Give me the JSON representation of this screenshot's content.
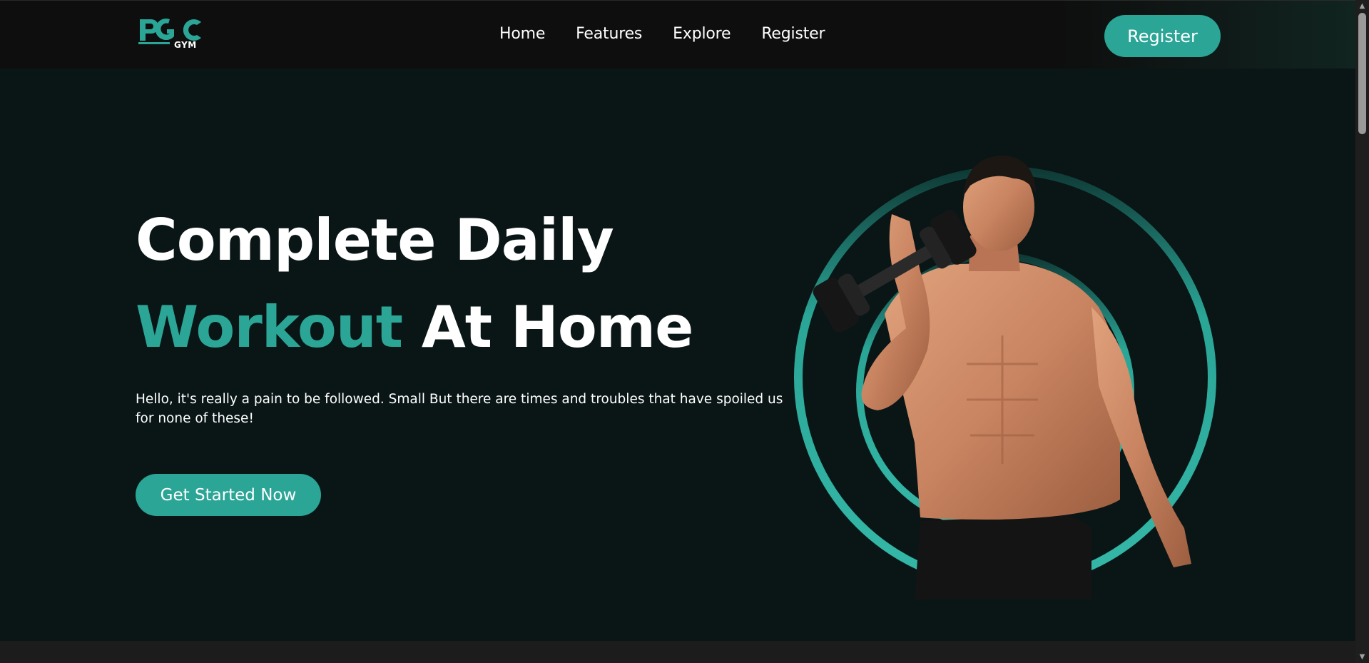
{
  "brand": {
    "logo_text": "PGC",
    "logo_subtext": "GYM",
    "accent_color": "#2aa596"
  },
  "nav": {
    "links": [
      {
        "label": "Home"
      },
      {
        "label": "Features"
      },
      {
        "label": "Explore"
      },
      {
        "label": "Register"
      }
    ],
    "register_button": "Register"
  },
  "hero": {
    "title_line1": "Complete Daily",
    "title_accent": "Workout",
    "title_rest": " At Home",
    "description": "Hello, it's really a pain to be followed. Small But there are times and troubles that have spoiled us for none of these!",
    "cta_label": "Get Started Now"
  },
  "icons": {
    "scroll_up": "scroll-up-arrow-icon",
    "scroll_down": "scroll-down-arrow-icon"
  }
}
